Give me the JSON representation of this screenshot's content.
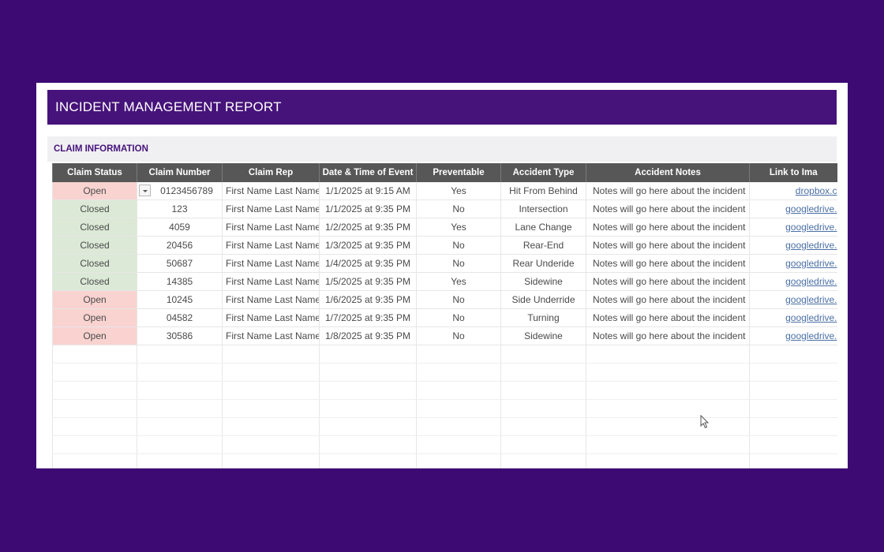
{
  "report": {
    "title": "INCIDENT MANAGEMENT REPORT",
    "section_label": "CLAIM INFORMATION"
  },
  "colors": {
    "background": "#3d0a73",
    "header_bar": "#46137a",
    "open_status": "#f8d3d0",
    "closed_status": "#dbe9d6",
    "column_header": "#575757",
    "link": "#4a6fa5"
  },
  "table": {
    "headers": [
      "Claim Status",
      "Claim Number",
      "Claim Rep",
      "Date & Time of Event",
      "Preventable",
      "Accident Type",
      "Accident Notes",
      "Link to Ima"
    ],
    "rows": [
      {
        "status": "Open",
        "number": "0123456789",
        "rep": "First Name Last Name",
        "datetime": "1/1/2025 at 9:15 AM",
        "preventable": "Yes",
        "type": "Hit From Behind",
        "notes": "Notes will go here about the incident",
        "link": "dropbox.c"
      },
      {
        "status": "Closed",
        "number": "123",
        "rep": "First Name Last Name",
        "datetime": "1/1/2025 at 9:35 PM",
        "preventable": "No",
        "type": "Intersection",
        "notes": "Notes will go here about the incident",
        "link": "googledrive."
      },
      {
        "status": "Closed",
        "number": "4059",
        "rep": "First Name Last Name",
        "datetime": "1/2/2025 at 9:35 PM",
        "preventable": "Yes",
        "type": "Lane Change",
        "notes": "Notes will go here about the incident",
        "link": "googledrive."
      },
      {
        "status": "Closed",
        "number": "20456",
        "rep": "First Name Last Name",
        "datetime": "1/3/2025 at 9:35 PM",
        "preventable": "No",
        "type": "Rear-End",
        "notes": "Notes will go here about the incident",
        "link": "googledrive."
      },
      {
        "status": "Closed",
        "number": "50687",
        "rep": "First Name Last Name",
        "datetime": "1/4/2025 at 9:35 PM",
        "preventable": "No",
        "type": "Rear Underide",
        "notes": "Notes will go here about the incident",
        "link": "googledrive."
      },
      {
        "status": "Closed",
        "number": "14385",
        "rep": "First Name Last Name",
        "datetime": "1/5/2025 at 9:35 PM",
        "preventable": "Yes",
        "type": "Sidewine",
        "notes": "Notes will go here about the incident",
        "link": "googledrive."
      },
      {
        "status": "Open",
        "number": "10245",
        "rep": "First Name Last Name",
        "datetime": "1/6/2025 at 9:35 PM",
        "preventable": "No",
        "type": "Side Underride",
        "notes": "Notes will go here about the incident",
        "link": "googledrive."
      },
      {
        "status": "Open",
        "number": "04582",
        "rep": "First Name Last Name",
        "datetime": "1/7/2025 at 9:35 PM",
        "preventable": "No",
        "type": "Turning",
        "notes": "Notes will go here about the incident",
        "link": "googledrive."
      },
      {
        "status": "Open",
        "number": "30586",
        "rep": "First Name Last Name",
        "datetime": "1/8/2025 at 9:35 PM",
        "preventable": "No",
        "type": "Sidewine",
        "notes": "Notes will go here about the incident",
        "link": "googledrive."
      }
    ]
  },
  "icons": {
    "dropdown": "chevron-down-icon",
    "cursor": "mouse-pointer-icon"
  }
}
